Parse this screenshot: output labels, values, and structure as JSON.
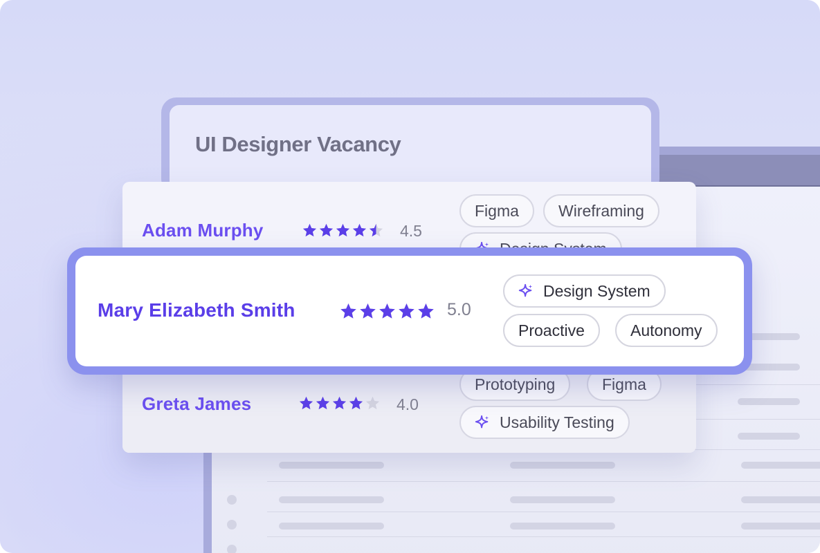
{
  "vacancy": {
    "title": "UI Designer Vacancy"
  },
  "candidates": [
    {
      "name": "Adam Murphy",
      "rating": 4.5,
      "rating_label": "4.5",
      "tags": [
        {
          "label": "Figma",
          "icon": ""
        },
        {
          "label": "Wireframing",
          "icon": ""
        },
        {
          "label": "Design System",
          "icon": "sparkle-icon"
        }
      ]
    },
    {
      "name": "Mary Elizabeth Smith",
      "rating": 5.0,
      "rating_label": "5.0",
      "highlighted": true,
      "tags": [
        {
          "label": "Design System",
          "icon": "sparkle-icon"
        },
        {
          "label": "Proactive",
          "icon": ""
        },
        {
          "label": "Autonomy",
          "icon": ""
        }
      ]
    },
    {
      "name": "Greta James",
      "rating": 4.0,
      "rating_label": "4.0",
      "tags": [
        {
          "label": "Prototyping",
          "icon": ""
        },
        {
          "label": "Figma",
          "icon": ""
        },
        {
          "label": "Usability Testing",
          "icon": "sparkle-icon"
        }
      ]
    }
  ],
  "colors": {
    "accent": "#6b4ff0",
    "star_filled": "#5b3fe8",
    "star_empty": "#d4d4e0",
    "highlight_border": "#8b91ee"
  }
}
